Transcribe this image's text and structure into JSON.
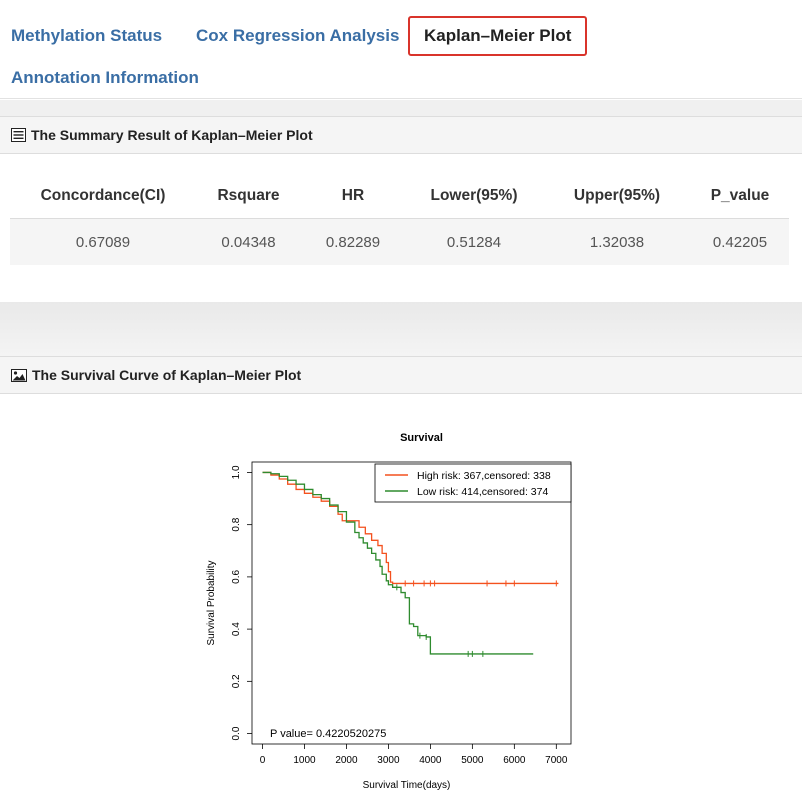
{
  "tabs": [
    {
      "label": "Methylation Status"
    },
    {
      "label": "Cox Regression Analysis"
    },
    {
      "label": "Kaplan–Meier Plot",
      "active": true
    },
    {
      "label": "Annotation Information"
    }
  ],
  "summary_panel": {
    "title": "The Summary Result of Kaplan–Meier Plot",
    "icon": "list-icon",
    "columns": [
      "Concordance(CI)",
      "Rsquare",
      "HR",
      "Lower(95%)",
      "Upper(95%)",
      "P_value"
    ],
    "row": [
      "0.67089",
      "0.04348",
      "0.82289",
      "0.51284",
      "1.32038",
      "0.42205"
    ]
  },
  "curve_panel": {
    "title": "The Survival Curve of Kaplan–Meier Plot",
    "icon": "image-icon"
  },
  "colors": {
    "tab_link": "#3a6ea5",
    "active_border": "#d9342b",
    "high_risk": "#f4511e",
    "low_risk": "#2e8b2e"
  },
  "chart_data": {
    "type": "line",
    "title": "Survival",
    "xlabel": "Survival Time(days)",
    "ylabel": "Survival Probability",
    "xlim": [
      0,
      7000
    ],
    "ylim": [
      0,
      1
    ],
    "xticks": [
      "0",
      "1000",
      "2000",
      "3000",
      "4000",
      "5000",
      "6000",
      "7000"
    ],
    "yticks": [
      "0.0",
      "0.2",
      "0.4",
      "0.6",
      "0.8",
      "1.0"
    ],
    "legend": [
      "High risk: 367,censored: 338",
      "Low  risk: 414,censored: 374"
    ],
    "legend_position": "top-right",
    "annotation": "P value= 0.4220520275",
    "series": [
      {
        "name": "High risk: 367,censored: 338",
        "color": "#f4511e",
        "points": [
          [
            0,
            1.0
          ],
          [
            200,
            0.99
          ],
          [
            400,
            0.975
          ],
          [
            600,
            0.955
          ],
          [
            800,
            0.935
          ],
          [
            1000,
            0.92
          ],
          [
            1200,
            0.905
          ],
          [
            1400,
            0.89
          ],
          [
            1600,
            0.87
          ],
          [
            1800,
            0.84
          ],
          [
            1900,
            0.815
          ],
          [
            2200,
            0.815
          ],
          [
            2300,
            0.79
          ],
          [
            2450,
            0.765
          ],
          [
            2600,
            0.74
          ],
          [
            2750,
            0.72
          ],
          [
            2850,
            0.69
          ],
          [
            2950,
            0.655
          ],
          [
            3000,
            0.62
          ],
          [
            3050,
            0.58
          ],
          [
            3100,
            0.575
          ],
          [
            7050,
            0.575
          ]
        ],
        "censored_x": [
          3400,
          3600,
          3850,
          4000,
          4100,
          5350,
          5800,
          6000,
          7000
        ]
      },
      {
        "name": "Low  risk: 414,censored: 374",
        "color": "#2e8b2e",
        "points": [
          [
            0,
            1.0
          ],
          [
            200,
            0.995
          ],
          [
            400,
            0.985
          ],
          [
            600,
            0.97
          ],
          [
            800,
            0.955
          ],
          [
            1000,
            0.935
          ],
          [
            1200,
            0.915
          ],
          [
            1400,
            0.9
          ],
          [
            1600,
            0.875
          ],
          [
            1800,
            0.85
          ],
          [
            2000,
            0.81
          ],
          [
            2200,
            0.77
          ],
          [
            2300,
            0.75
          ],
          [
            2400,
            0.73
          ],
          [
            2500,
            0.71
          ],
          [
            2600,
            0.69
          ],
          [
            2700,
            0.665
          ],
          [
            2800,
            0.64
          ],
          [
            2850,
            0.61
          ],
          [
            2950,
            0.585
          ],
          [
            3000,
            0.57
          ],
          [
            3100,
            0.56
          ],
          [
            3300,
            0.54
          ],
          [
            3400,
            0.52
          ],
          [
            3500,
            0.42
          ],
          [
            3600,
            0.41
          ],
          [
            3700,
            0.375
          ],
          [
            3900,
            0.37
          ],
          [
            4000,
            0.305
          ],
          [
            6450,
            0.305
          ]
        ],
        "censored_x": [
          3200,
          3750,
          3900,
          4900,
          5000,
          5250
        ]
      }
    ]
  }
}
